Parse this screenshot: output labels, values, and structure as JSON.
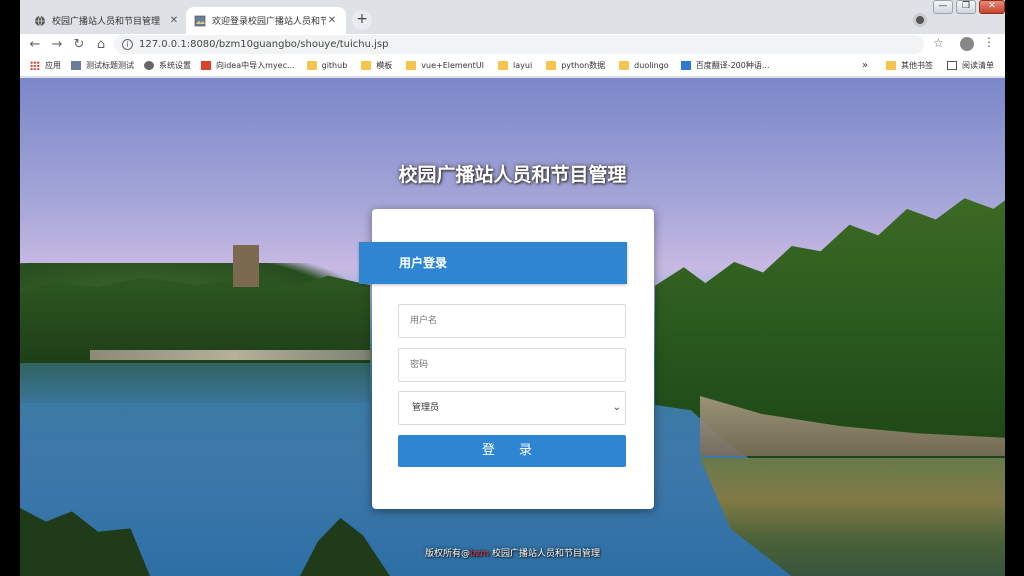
{
  "browser": {
    "tabs": [
      {
        "title": "校园广播站人员和节目管理",
        "active": false
      },
      {
        "title": "欢迎登录校园广播站人员和节目管理",
        "active": true
      }
    ],
    "new_tab_symbol": "+",
    "address": "127.0.0.1:8080/bzm10guangbo/shouye/tuichu.jsp",
    "window_buttons": {
      "minimize": "—",
      "maximize": "❐",
      "close": "✕"
    }
  },
  "bookmarks": {
    "items": [
      {
        "label": "应用",
        "icon": "apps-icon"
      },
      {
        "label": "测试标题测试",
        "icon": "image-icon"
      },
      {
        "label": "系统设置",
        "icon": "globe-icon"
      },
      {
        "label": "向idea中导入myec...",
        "icon": "red-c-icon"
      },
      {
        "label": "github",
        "icon": "folder-icon"
      },
      {
        "label": "模板",
        "icon": "folder-icon"
      },
      {
        "label": "vue+ElementUI",
        "icon": "folder-icon"
      },
      {
        "label": "layui",
        "icon": "folder-icon"
      },
      {
        "label": "python数据",
        "icon": "folder-icon"
      },
      {
        "label": "duolingo",
        "icon": "folder-icon"
      },
      {
        "label": "百度翻译-200种语...",
        "icon": "translate-icon"
      }
    ],
    "overflow": "»",
    "other": "其他书签",
    "reading_list": "阅读清单"
  },
  "page": {
    "title": "校园广播站人员和节目管理",
    "login_header": "用户登录",
    "username_placeholder": "用户名",
    "password_placeholder": "密码",
    "role_selected": "管理员",
    "login_button": "登 录",
    "footer_prefix": "版权所有@",
    "footer_brand": "bzm",
    "footer_suffix": " 校园广播站人员和节目管理"
  },
  "colors": {
    "accent": "#2e86d3",
    "footer_brand": "#e02a2a"
  }
}
